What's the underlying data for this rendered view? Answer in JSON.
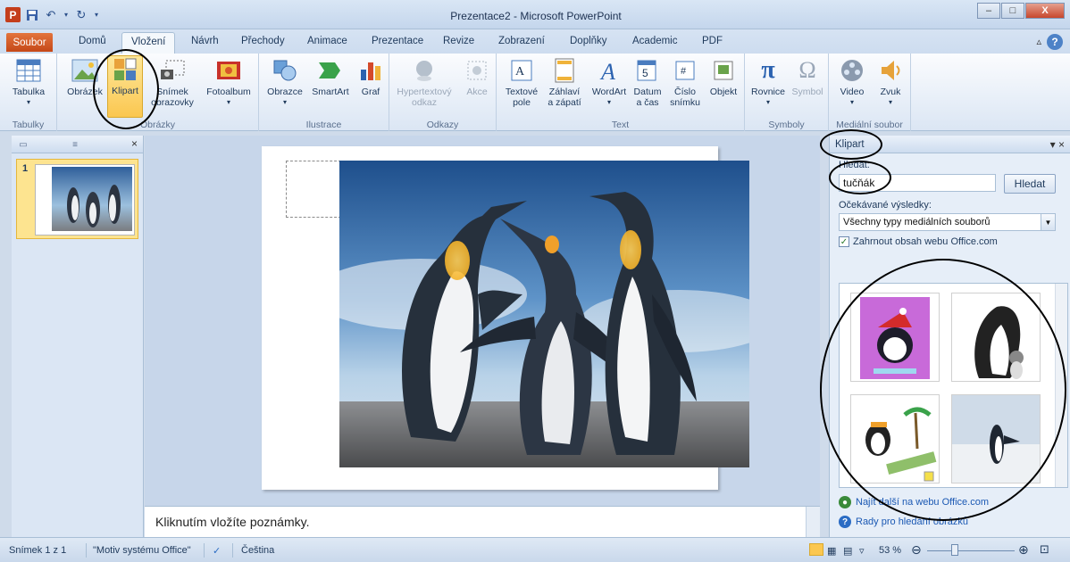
{
  "window": {
    "title": "Prezentace2 - Microsoft PowerPoint",
    "logo_letter": "P",
    "controls": {
      "minimize": "–",
      "maximize": "□",
      "close": "X"
    }
  },
  "tabs": {
    "file": "Soubor",
    "home": "Domů",
    "insert": "Vložení",
    "design": "Návrh",
    "transitions": "Přechody",
    "animations": "Animace",
    "slideshow": "Prezentace",
    "review": "Revize",
    "view": "Zobrazení",
    "addins": "Doplňky",
    "academic": "Academic",
    "pdf": "PDF",
    "help": "?",
    "minimize_ribbon": "▵"
  },
  "ribbon": {
    "groups": {
      "tables": "Tabulky",
      "images": "Obrázky",
      "illustrations": "Ilustrace",
      "links": "Odkazy",
      "text": "Text",
      "symbols": "Symboly",
      "media": "Mediální soubor"
    },
    "buttons": {
      "table": "Tabulka",
      "picture": "Obrázek",
      "clipart": "Klipart",
      "screenshot_1": "Snímek",
      "screenshot_2": "obrazovky",
      "photo_album": "Fotoalbum",
      "shapes": "Obrazce",
      "smartart": "SmartArt",
      "chart": "Graf",
      "hyperlink_1": "Hypertextový",
      "hyperlink_2": "odkaz",
      "action": "Akce",
      "textbox_1": "Textové",
      "textbox_2": "pole",
      "header_1": "Záhlaví",
      "header_2": "a zápatí",
      "wordart": "WordArt",
      "datetime_1": "Datum",
      "datetime_2": "a čas",
      "slidenum_1": "Číslo",
      "slidenum_2": "snímku",
      "object": "Objekt",
      "equation": "Rovnice",
      "symbol": "Symbol",
      "video": "Video",
      "audio": "Zvuk"
    }
  },
  "left_panel": {
    "slide_number": "1",
    "close": "×"
  },
  "notes": {
    "placeholder": "Kliknutím vložíte poznámky."
  },
  "clipart_pane": {
    "title": "Klipart",
    "search_label": "Hledat:",
    "search_value": "tučňák",
    "search_button": "Hledat",
    "results_label": "Očekávané výsledky:",
    "media_type": "Všechny typy mediálních souborů",
    "include_office_label": "Zahrnout obsah webu Office.com",
    "include_office_checked": true,
    "link_more": "Najít další na webu Office.com",
    "link_tips": "Rady pro hledání obrázků",
    "controls": "▾ ×"
  },
  "statusbar": {
    "slide": "Snímek 1 z 1",
    "theme": "\"Motiv systému Office\"",
    "language": "Čeština",
    "zoom": "53 %"
  },
  "colors": {
    "accent": "#c54818",
    "ribbon_bg": "#dbe6f4",
    "selected": "#fbc750"
  }
}
